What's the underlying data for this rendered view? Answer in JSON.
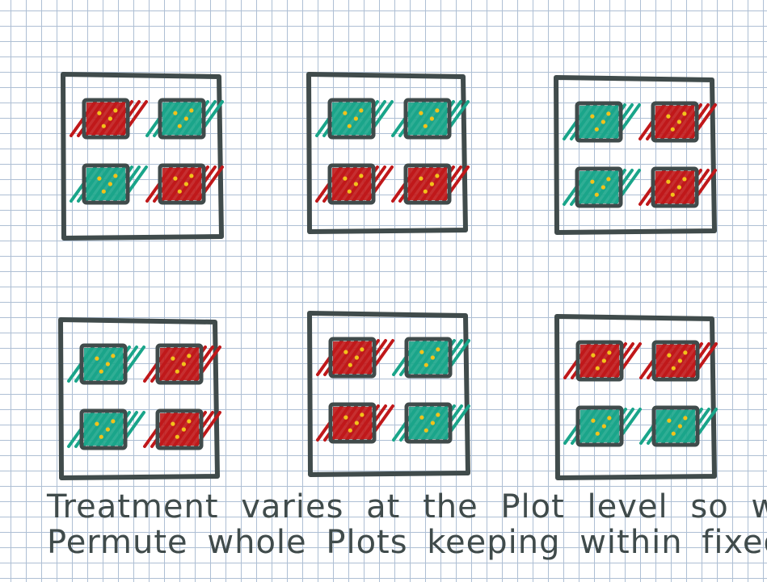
{
  "caption": {
    "line1": "Treatment varies at the Plot level so we",
    "line2": "Permute whole Plots keeping within fixed"
  },
  "colors": {
    "red": "#c0181a",
    "teal": "#1aa58a",
    "dot": "#f2c21a",
    "ink": "#404b4b",
    "grid": "#aebfd4"
  },
  "blocks": [
    {
      "plots": [
        [
          "red",
          "teal"
        ],
        [
          "teal",
          "red"
        ]
      ]
    },
    {
      "plots": [
        [
          "teal",
          "teal"
        ],
        [
          "red",
          "red"
        ]
      ]
    },
    {
      "plots": [
        [
          "teal",
          "red"
        ],
        [
          "teal",
          "red"
        ]
      ]
    },
    {
      "plots": [
        [
          "teal",
          "red"
        ],
        [
          "teal",
          "red"
        ]
      ]
    },
    {
      "plots": [
        [
          "red",
          "teal"
        ],
        [
          "red",
          "teal"
        ]
      ]
    },
    {
      "plots": [
        [
          "red",
          "red"
        ],
        [
          "teal",
          "teal"
        ]
      ]
    }
  ]
}
